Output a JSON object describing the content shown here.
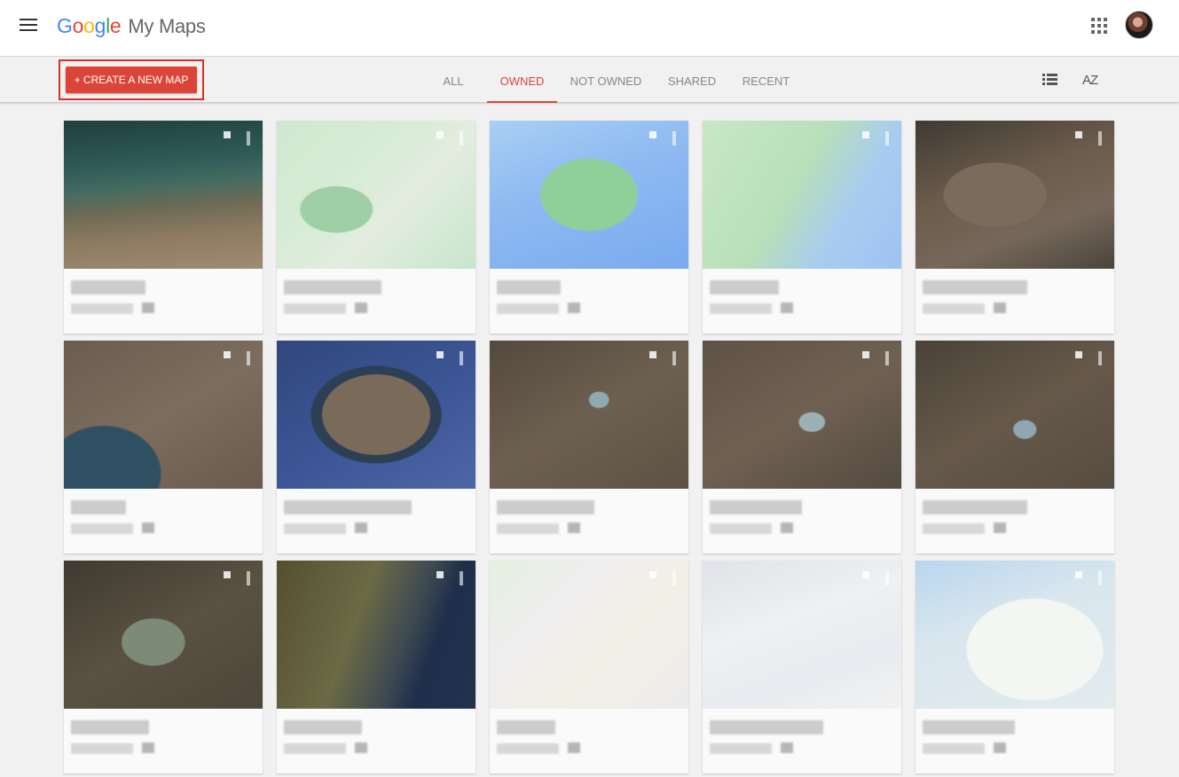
{
  "header": {
    "logo_letters": [
      "G",
      "o",
      "o",
      "g",
      "l",
      "e"
    ],
    "product_name": "My Maps",
    "brand_colors": {
      "blue": "#4285F4",
      "red": "#EA4335",
      "yellow": "#FBBC05",
      "green": "#34A853"
    }
  },
  "toolbar": {
    "create_label": "+ CREATE A NEW MAP",
    "accent": "#db4437",
    "tabs": [
      {
        "label": "ALL",
        "active": false
      },
      {
        "label": "OWNED",
        "active": true
      },
      {
        "label": "NOT OWNED",
        "active": false
      },
      {
        "label": "SHARED",
        "active": false
      },
      {
        "label": "RECENT",
        "active": false
      }
    ],
    "sort_label": "AZ",
    "view_icon": "list-view-icon"
  },
  "cards": [
    {
      "title": "",
      "date": "",
      "style": "m-coast"
    },
    {
      "title": "",
      "date": "",
      "style": "m-road"
    },
    {
      "title": "",
      "date": "",
      "style": "m-ireland"
    },
    {
      "title": "",
      "date": "",
      "style": "m-coastmap"
    },
    {
      "title": "",
      "date": "",
      "style": "m-sat1"
    },
    {
      "title": "",
      "date": "",
      "style": "m-sat2"
    },
    {
      "title": "",
      "date": "",
      "style": "m-island"
    },
    {
      "title": "",
      "date": "",
      "style": "m-sat3"
    },
    {
      "title": "",
      "date": "",
      "style": "m-sat4"
    },
    {
      "title": "",
      "date": "",
      "style": "m-sat5"
    },
    {
      "title": "",
      "date": "",
      "style": "m-sat6"
    },
    {
      "title": "",
      "date": "",
      "style": "m-sat7"
    },
    {
      "title": "",
      "date": "",
      "style": "m-light1"
    },
    {
      "title": "",
      "date": "",
      "style": "m-light2"
    },
    {
      "title": "",
      "date": "",
      "style": "m-light3"
    }
  ]
}
